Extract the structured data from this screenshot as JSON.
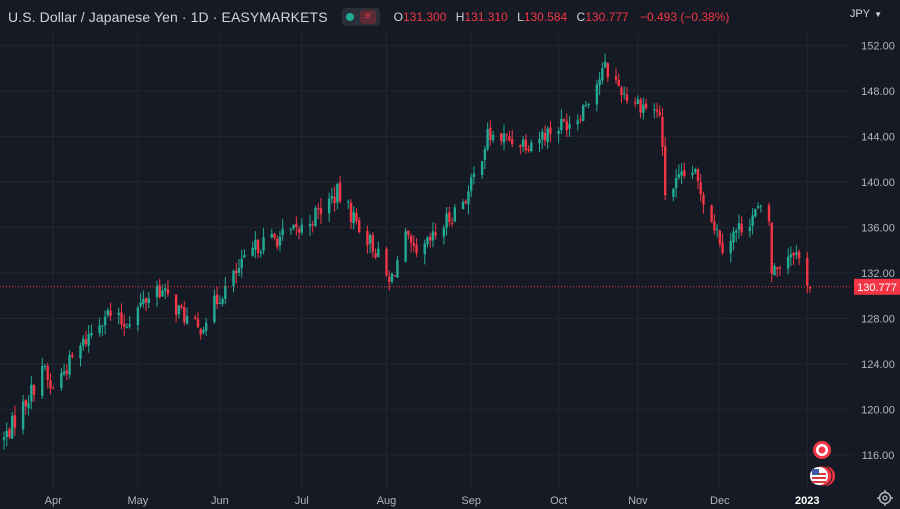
{
  "header": {
    "title": "U.S. Dollar / Japanese Yen · 1D · EASYMARKETS",
    "open_label": "O",
    "open": "131.300",
    "high_label": "H",
    "high": "131.310",
    "low_label": "L",
    "low": "130.584",
    "close_label": "C",
    "close": "130.777",
    "change": "−0.493 (−0.38%)"
  },
  "currency": "JPY",
  "last_price_label": "130.777",
  "colors": {
    "background": "#161a25",
    "grid": "#232733",
    "up": "#22ab94",
    "down": "#f23645",
    "text": "#d1d4dc",
    "axis_text": "#b2b5be"
  },
  "icons": [
    "settings-gear-icon",
    "event-flag-icon",
    "us-flag-icon",
    "chevron-down-icon"
  ],
  "chart_data": {
    "type": "candlestick",
    "symbol": "USDJPY",
    "timeframe": "1D",
    "ylim": [
      113.0,
      153.0
    ],
    "ytick_labels": [
      "116.00",
      "120.00",
      "124.00",
      "128.00",
      "132.00",
      "136.00",
      "140.00",
      "144.00",
      "148.00",
      "152.00"
    ],
    "yticks": [
      116,
      120,
      124,
      128,
      132,
      136,
      140,
      144,
      148,
      152
    ],
    "xtick_labels": [
      "Apr",
      "May",
      "Jun",
      "Jul",
      "Aug",
      "Sep",
      "Oct",
      "Nov",
      "Dec",
      "2023"
    ],
    "xtick_dates": [
      "2022-04-01",
      "2022-05-02",
      "2022-06-01",
      "2022-07-01",
      "2022-08-01",
      "2022-09-01",
      "2022-10-03",
      "2022-11-01",
      "2022-12-01",
      "2023-01-02"
    ],
    "date_range": [
      "2022-03-14",
      "2023-01-03"
    ],
    "last_price": 130.777,
    "grid": true,
    "anchors": [
      [
        "2022-03-14",
        117.4
      ],
      [
        "2022-03-25",
        122.0
      ],
      [
        "2022-03-28",
        124.0
      ],
      [
        "2022-03-31",
        121.7
      ],
      [
        "2022-04-20",
        128.5
      ],
      [
        "2022-04-27",
        127.5
      ],
      [
        "2022-05-09",
        130.8
      ],
      [
        "2022-05-24",
        126.9
      ],
      [
        "2022-06-01",
        130.0
      ],
      [
        "2022-06-15",
        134.5
      ],
      [
        "2022-06-30",
        135.7
      ],
      [
        "2022-07-14",
        139.0
      ],
      [
        "2022-07-28",
        134.0
      ],
      [
        "2022-08-02",
        131.0
      ],
      [
        "2022-08-08",
        135.0
      ],
      [
        "2022-08-12",
        133.2
      ],
      [
        "2022-08-31",
        139.0
      ],
      [
        "2022-09-07",
        144.0
      ],
      [
        "2022-09-22",
        143.5
      ],
      [
        "2022-10-10",
        145.8
      ],
      [
        "2022-10-20",
        150.0
      ],
      [
        "2022-10-28",
        147.5
      ],
      [
        "2022-11-09",
        146.0
      ],
      [
        "2022-11-11",
        139.0
      ],
      [
        "2022-11-21",
        141.0
      ],
      [
        "2022-12-02",
        134.5
      ],
      [
        "2022-12-15",
        137.5
      ],
      [
        "2022-12-19",
        136.5
      ],
      [
        "2022-12-20",
        132.0
      ],
      [
        "2022-12-28",
        134.2
      ],
      [
        "2023-01-03",
        130.8
      ]
    ]
  }
}
